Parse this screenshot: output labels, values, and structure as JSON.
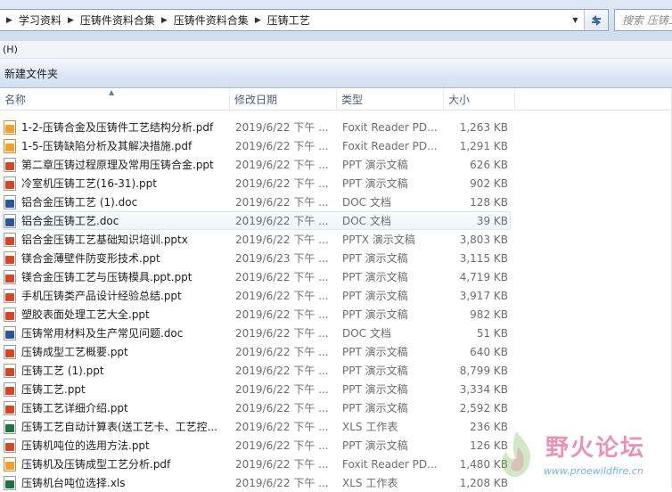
{
  "address_bar": {
    "breadcrumbs": [
      "学习资料",
      "压铸件资料合集",
      "压铸件资料合集",
      "压铸工艺"
    ]
  },
  "search": {
    "placeholder": "搜索 压铸工..."
  },
  "menu": {
    "items": [
      "(H)"
    ]
  },
  "command_bar": {
    "new_folder_label": "新建文件夹"
  },
  "columns": {
    "name": "名称",
    "date": "修改日期",
    "type": "类型",
    "size": "大小"
  },
  "files": [
    {
      "name": "1-2-压铸合金及压铸件工艺结构分析.pdf",
      "date": "2019/6/22 下午 ...",
      "type": "Foxit Reader PD...",
      "size": "1,263 KB",
      "icon": "pdf"
    },
    {
      "name": "1-5-压铸缺陷分析及其解决措施.pdf",
      "date": "2019/6/22 下午 ...",
      "type": "Foxit Reader PD...",
      "size": "1,291 KB",
      "icon": "pdf"
    },
    {
      "name": "第二章压铸过程原理及常用压铸合金.ppt",
      "date": "2019/6/22 下午 ...",
      "type": "PPT 演示文稿",
      "size": "626 KB",
      "icon": "ppt"
    },
    {
      "name": "冷室机压铸工艺(16-31).ppt",
      "date": "2019/6/22 下午 ...",
      "type": "PPT 演示文稿",
      "size": "902 KB",
      "icon": "ppt"
    },
    {
      "name": "铝合金压铸工艺 (1).doc",
      "date": "2019/6/22 下午 ...",
      "type": "DOC 文档",
      "size": "128 KB",
      "icon": "doc"
    },
    {
      "name": "铝合金压铸工艺.doc",
      "date": "2019/6/22 下午 ...",
      "type": "DOC 文档",
      "size": "39 KB",
      "icon": "doc"
    },
    {
      "name": "铝合金压铸工艺基础知识培训.pptx",
      "date": "2019/6/22 下午 ...",
      "type": "PPTX 演示文稿",
      "size": "3,803 KB",
      "icon": "ppt"
    },
    {
      "name": "镁合金薄壁件防变形技术.ppt",
      "date": "2019/6/23 下午 ...",
      "type": "PPT 演示文稿",
      "size": "3,115 KB",
      "icon": "ppt"
    },
    {
      "name": "镁合金压铸工艺与压铸模具.ppt.ppt",
      "date": "2019/6/22 下午 ...",
      "type": "PPT 演示文稿",
      "size": "4,719 KB",
      "icon": "ppt"
    },
    {
      "name": "手机压铸类产品设计经验总结.ppt",
      "date": "2019/6/22 下午 ...",
      "type": "PPT 演示文稿",
      "size": "3,917 KB",
      "icon": "ppt"
    },
    {
      "name": "塑胶表面处理工艺大全.ppt",
      "date": "2019/6/22 下午 ...",
      "type": "PPT 演示文稿",
      "size": "982 KB",
      "icon": "ppt"
    },
    {
      "name": "压铸常用材料及生产常见问题.doc",
      "date": "2019/6/22 下午 ...",
      "type": "DOC 文档",
      "size": "51 KB",
      "icon": "doc"
    },
    {
      "name": "压铸成型工艺概要.ppt",
      "date": "2019/6/22 下午 ...",
      "type": "PPT 演示文稿",
      "size": "640 KB",
      "icon": "ppt"
    },
    {
      "name": "压铸工艺 (1).ppt",
      "date": "2019/6/22 下午 ...",
      "type": "PPT 演示文稿",
      "size": "8,799 KB",
      "icon": "ppt"
    },
    {
      "name": "压铸工艺.ppt",
      "date": "2019/6/22 下午 ...",
      "type": "PPT 演示文稿",
      "size": "3,334 KB",
      "icon": "ppt"
    },
    {
      "name": "压铸工艺详细介绍.ppt",
      "date": "2019/6/22 下午 ...",
      "type": "PPT 演示文稿",
      "size": "2,592 KB",
      "icon": "ppt"
    },
    {
      "name": "压铸工艺自动计算表(送工艺卡、工艺控...",
      "date": "2019/6/22 下午 ...",
      "type": "XLS 工作表",
      "size": "236 KB",
      "icon": "xls"
    },
    {
      "name": "压铸机吨位的选用方法.ppt",
      "date": "2019/6/22 下午 ...",
      "type": "PPT 演示文稿",
      "size": "126 KB",
      "icon": "ppt"
    },
    {
      "name": "压铸机及压铸成型工艺分析.pdf",
      "date": "2019/6/22 下午 ...",
      "type": "Foxit Reader PD...",
      "size": "1,480 KB",
      "icon": "pdf"
    },
    {
      "name": "压铸机台吨位选择.xls",
      "date": "2019/6/22 下午 ...",
      "type": "XLS 工作表",
      "size": "1,208 KB",
      "icon": "xls"
    }
  ],
  "selected_index": 5,
  "watermark": {
    "title": "野火论坛",
    "url": "www.proewildfire.cn"
  }
}
